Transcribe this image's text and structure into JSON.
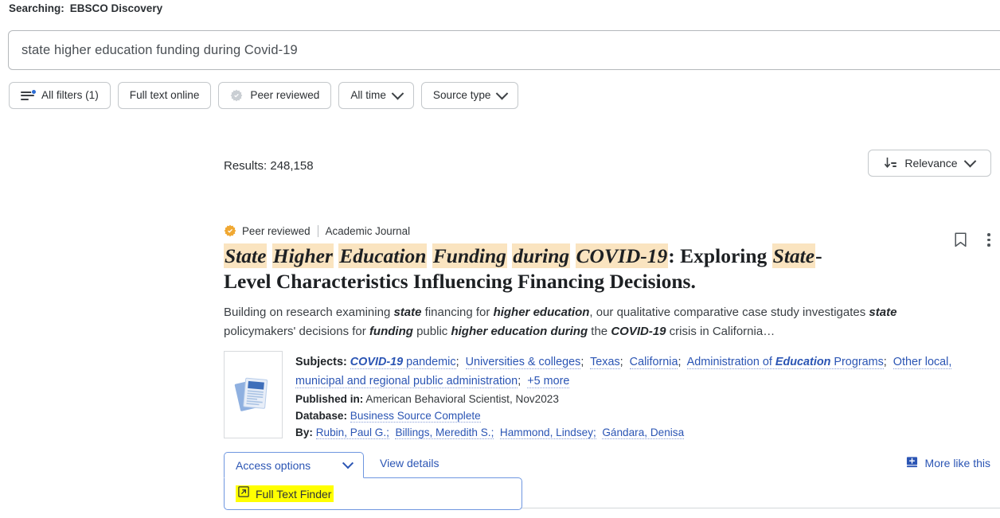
{
  "header": {
    "searching_label": "Searching:",
    "searching_value": "EBSCO Discovery"
  },
  "search": {
    "value": "state higher education funding during Covid-19",
    "placeholder": "Search"
  },
  "filters": [
    {
      "label": "All filters (1)",
      "icon": "filters-icon",
      "has_badge": true,
      "has_chevron": false
    },
    {
      "label": "Full text online",
      "icon": "",
      "has_badge": false,
      "has_chevron": false
    },
    {
      "label": "Peer reviewed",
      "icon": "rosette-check-icon",
      "has_badge": false,
      "has_chevron": false
    },
    {
      "label": "All time",
      "icon": "",
      "has_badge": false,
      "has_chevron": true
    },
    {
      "label": "Source type",
      "icon": "",
      "has_badge": false,
      "has_chevron": true
    }
  ],
  "results": {
    "count_text": "Results: 248,158",
    "sort_label": "Relevance"
  },
  "item": {
    "peer_reviewed_label": "Peer reviewed",
    "doc_type": "Academic Journal",
    "title_parts": [
      {
        "text": "State",
        "highlight": true
      },
      {
        "text": " ",
        "highlight": false
      },
      {
        "text": "Higher",
        "highlight": true
      },
      {
        "text": " ",
        "highlight": false
      },
      {
        "text": "Education",
        "highlight": true
      },
      {
        "text": " ",
        "highlight": false
      },
      {
        "text": "Funding",
        "highlight": true
      },
      {
        "text": " ",
        "highlight": false
      },
      {
        "text": "during",
        "highlight": true
      },
      {
        "text": " ",
        "highlight": false
      },
      {
        "text": "COVID-19",
        "highlight": true
      },
      {
        "text": ": Exploring ",
        "highlight": false
      },
      {
        "text": "State",
        "highlight": true
      },
      {
        "text": "-Level Characteristics Influencing Financing Decisions.",
        "highlight": false
      }
    ],
    "abstract_parts": [
      {
        "text": "Building on research examining ",
        "bold": false
      },
      {
        "text": "state",
        "bold": true
      },
      {
        "text": " financing for ",
        "bold": false
      },
      {
        "text": "higher education",
        "bold": true
      },
      {
        "text": ", our qualitative comparative case study investigates ",
        "bold": false
      },
      {
        "text": "state",
        "bold": true
      },
      {
        "text": " policymakers' decisions for ",
        "bold": false
      },
      {
        "text": "funding",
        "bold": true
      },
      {
        "text": " public ",
        "bold": false
      },
      {
        "text": "higher education during",
        "bold": true
      },
      {
        "text": " the ",
        "bold": false
      },
      {
        "text": "COVID-19",
        "bold": true
      },
      {
        "text": " crisis in California…",
        "bold": false
      }
    ],
    "subjects_key": "Subjects:",
    "subjects": [
      {
        "pre_italic": "COVID-19",
        "text": " pandemic"
      },
      {
        "pre_italic": "",
        "text": "Universities & colleges"
      },
      {
        "pre_italic": "",
        "text": "Texas"
      },
      {
        "pre_italic": "",
        "text": "California"
      },
      {
        "pre_italic": "",
        "text": "Administration of Education Programs"
      },
      {
        "pre_italic": "",
        "text": "Other local, municipal and regional public administration"
      }
    ],
    "subjects_more": "+5 more",
    "published_key": "Published in:",
    "published_value": "American Behavioral Scientist, Nov2023",
    "database_key": "Database:",
    "database_value": "Business Source Complete",
    "by_key": "By:",
    "authors": [
      "Rubin, Paul G.;",
      "Billings, Meredith S.;",
      "Hammond, Lindsey;",
      "Gándara, Denisa"
    ],
    "access_options_label": "Access options",
    "full_text_finder_label": "Full Text Finder",
    "view_details_label": "View details",
    "more_like_this_label": "More like this",
    "save_icon": "bookmark-icon",
    "menu_icon": "kebab-menu-icon",
    "thumbnail_icon": "document-placeholder-icon"
  },
  "colors": {
    "link": "#2b55b4",
    "highlight": "#fae4c0",
    "yellow_highlight": "#ffff00",
    "peer_badge": "#f0a832",
    "accent_dot": "#2b6cd4"
  }
}
